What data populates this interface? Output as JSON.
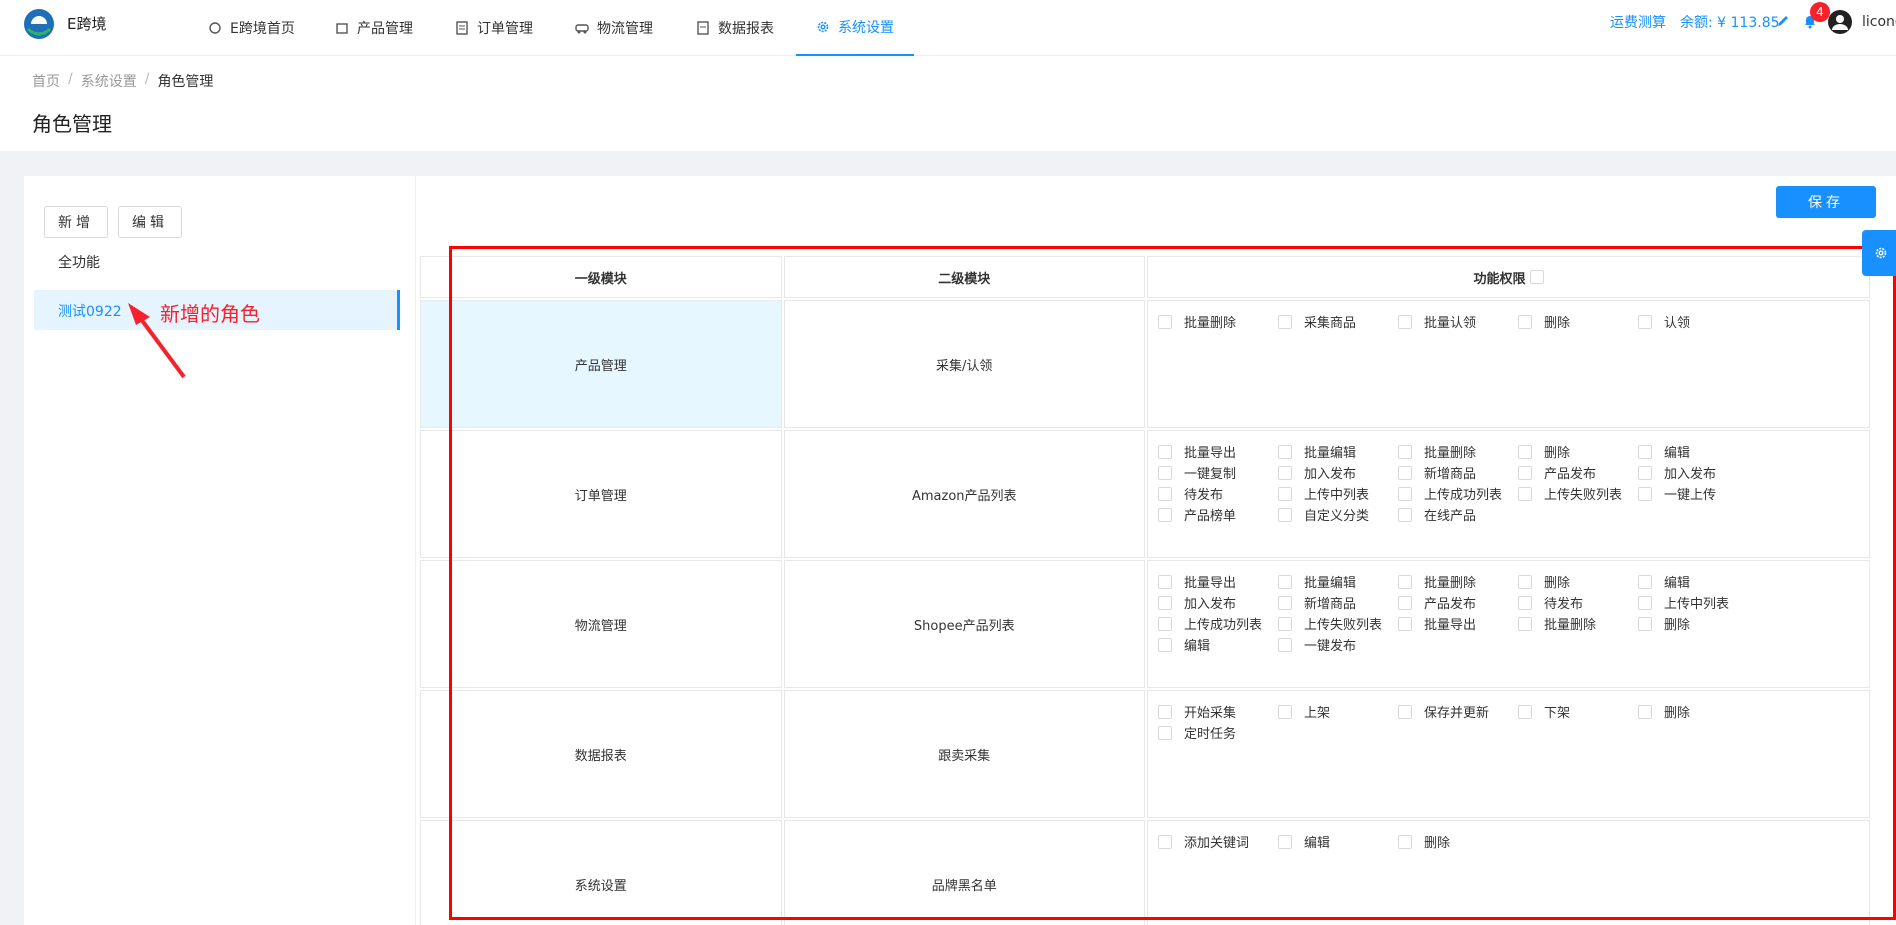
{
  "brand": "E跨境",
  "nav": [
    {
      "label": "E跨境首页",
      "icon": "home-icon"
    },
    {
      "label": "产品管理",
      "icon": "box-icon"
    },
    {
      "label": "订单管理",
      "icon": "order-icon"
    },
    {
      "label": "物流管理",
      "icon": "truck-icon"
    },
    {
      "label": "数据报表",
      "icon": "report-icon"
    },
    {
      "label": "系统设置",
      "icon": "gear-icon"
    }
  ],
  "header_right": {
    "freight": "运费测算",
    "balance": "余额: ¥ 113.85",
    "badge": "4",
    "user": "licong"
  },
  "breadcrumb": [
    "首页",
    "系统设置",
    "角色管理"
  ],
  "page_title": "角色管理",
  "left": {
    "add": "新增",
    "edit": "编辑",
    "all": "全功能",
    "selected_role": "测试0922",
    "annotation": "新增的角色"
  },
  "save": "保存",
  "table": {
    "headers": [
      "一级模块",
      "二级模块",
      "功能权限"
    ],
    "rows": [
      {
        "m1": "产品管理",
        "m2": "采集/认领",
        "perms": [
          "批量删除",
          "采集商品",
          "批量认领",
          "删除",
          "认领"
        ]
      },
      {
        "m1": "订单管理",
        "m2": "Amazon产品列表",
        "perms": [
          "批量导出",
          "批量编辑",
          "批量删除",
          "删除",
          "编辑",
          "一键复制",
          "加入发布",
          "新增商品",
          "产品发布",
          "加入发布",
          "待发布",
          "上传中列表",
          "上传成功列表",
          "上传失败列表",
          "一键上传",
          "产品榜单",
          "自定义分类",
          "在线产品"
        ]
      },
      {
        "m1": "物流管理",
        "m2": "Shopee产品列表",
        "perms": [
          "批量导出",
          "批量编辑",
          "批量删除",
          "删除",
          "编辑",
          "加入发布",
          "新增商品",
          "产品发布",
          "待发布",
          "上传中列表",
          "上传成功列表",
          "上传失败列表",
          "批量导出",
          "批量删除",
          "删除",
          "编辑",
          "一键发布"
        ]
      },
      {
        "m1": "数据报表",
        "m2": "跟卖采集",
        "perms": [
          "开始采集",
          "上架",
          "保存并更新",
          "下架",
          "删除",
          "定时任务"
        ]
      },
      {
        "m1": "系统设置",
        "m2": "品牌黑名单",
        "perms": [
          "添加关键词",
          "编辑",
          "删除"
        ]
      }
    ]
  },
  "colors": {
    "primary": "#1890ff",
    "annotation": "#f5222d"
  }
}
